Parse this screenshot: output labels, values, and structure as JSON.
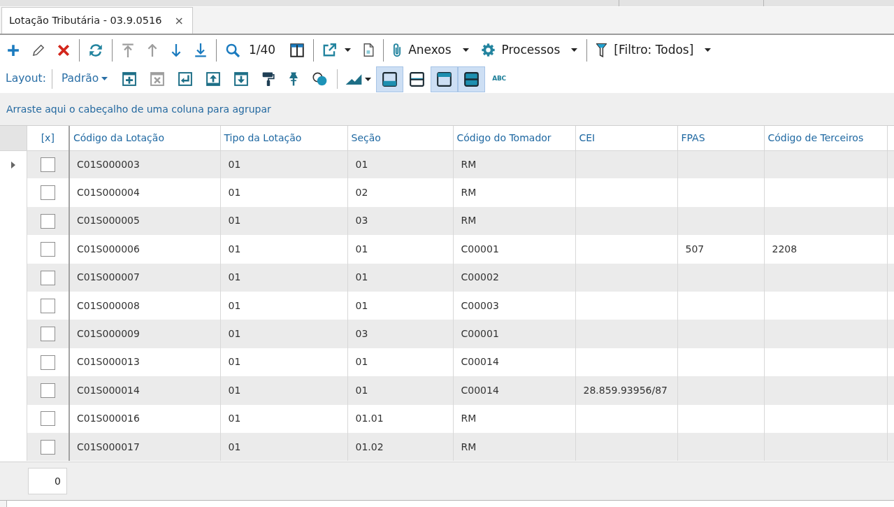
{
  "tabs": [
    {
      "label": "Lotação Tributária - 03.9.0516",
      "close": "×",
      "selected": true
    }
  ],
  "toolbar": [
    {
      "kind": "button",
      "disabled": false
    },
    {
      "kind": "button",
      "disabled": false
    },
    {
      "kind": "button",
      "disabled": false
    },
    {
      "kind": "separator"
    },
    {
      "kind": "button",
      "disabled": false
    },
    {
      "kind": "separator"
    },
    {
      "kind": "button",
      "disabled": true
    },
    {
      "kind": "button",
      "disabled": true
    },
    {
      "kind": "button",
      "disabled": false
    },
    {
      "kind": "button",
      "disabled": false
    },
    {
      "kind": "separator"
    },
    {
      "kind": "button",
      "disabled": false
    },
    {
      "kind": "text",
      "text": "1/40"
    },
    {
      "kind": "button",
      "disabled": false
    },
    {
      "kind": "separator"
    },
    {
      "kind": "dropdown-button",
      "disabled": false
    },
    {
      "kind": "button",
      "disabled": false
    },
    {
      "kind": "separator"
    },
    {
      "kind": "menu",
      "label": "Anexos",
      "disabled": false
    },
    {
      "kind": "menu",
      "label": "Processos",
      "disabled": false
    },
    {
      "kind": "separator"
    },
    {
      "kind": "menu",
      "label": "[Filtro: Todos]",
      "disabled": false
    }
  ],
  "layout_bar": {
    "label": "Layout:",
    "dropdown": "Padrão",
    "items": [
      {
        "kind": "button",
        "disabled": false
      },
      {
        "kind": "button",
        "disabled": true
      },
      {
        "kind": "button",
        "disabled": false
      },
      {
        "kind": "button",
        "disabled": false
      },
      {
        "kind": "button",
        "disabled": false
      },
      {
        "kind": "button",
        "disabled": false
      },
      {
        "kind": "button",
        "disabled": false
      },
      {
        "kind": "button",
        "disabled": false
      },
      {
        "kind": "separator"
      },
      {
        "kind": "dropdown-button",
        "disabled": false
      },
      {
        "kind": "toggle",
        "selected": true
      },
      {
        "kind": "toggle",
        "selected": false
      },
      {
        "kind": "toggle",
        "selected": true
      },
      {
        "kind": "toggle",
        "selected": true
      },
      {
        "kind": "text-button",
        "label": "ABC"
      }
    ]
  },
  "group_panel": {
    "hint": "Arraste aqui o cabeçalho de uma coluna para agrupar"
  },
  "table": {
    "checkbox_column": {
      "label": "[x]"
    },
    "columns": [
      {
        "label": "Código da Lotação"
      },
      {
        "label": "Tipo da Lotação"
      },
      {
        "label": "Seção"
      },
      {
        "label": "Código do Tomador"
      },
      {
        "label": "CEI"
      },
      {
        "label": "FPAS"
      },
      {
        "label": "Código de Terceiros"
      }
    ],
    "rows": [
      {
        "current": true,
        "checked": false,
        "cells": [
          "C01S000003",
          "01",
          "01",
          "RM",
          null,
          null,
          null
        ]
      },
      {
        "current": false,
        "checked": false,
        "cells": [
          "C01S000004",
          "01",
          "02",
          "RM",
          null,
          null,
          null
        ]
      },
      {
        "current": false,
        "checked": false,
        "cells": [
          "C01S000005",
          "01",
          "03",
          "RM",
          null,
          null,
          null
        ]
      },
      {
        "current": false,
        "checked": false,
        "cells": [
          "C01S000006",
          "01",
          "01",
          "C00001",
          null,
          "507",
          "2208"
        ]
      },
      {
        "current": false,
        "checked": false,
        "cells": [
          "C01S000007",
          "01",
          "01",
          "C00002",
          null,
          null,
          null
        ]
      },
      {
        "current": false,
        "checked": false,
        "cells": [
          "C01S000008",
          "01",
          "01",
          "C00003",
          null,
          null,
          null
        ]
      },
      {
        "current": false,
        "checked": false,
        "cells": [
          "C01S000009",
          "01",
          "03",
          "C00001",
          null,
          null,
          null
        ]
      },
      {
        "current": false,
        "checked": false,
        "cells": [
          "C01S000013",
          "01",
          "01",
          "C00014",
          null,
          null,
          null
        ]
      },
      {
        "current": false,
        "checked": false,
        "cells": [
          "C01S000014",
          "01",
          "01",
          "C00014",
          "28.859.93956/87",
          null,
          null
        ]
      },
      {
        "current": false,
        "checked": false,
        "cells": [
          "C01S000016",
          "01",
          "01.01",
          "RM",
          null,
          null,
          null
        ]
      },
      {
        "current": false,
        "checked": false,
        "cells": [
          "C01S000017",
          "01",
          "01.02",
          "RM",
          null,
          null,
          null
        ]
      }
    ]
  },
  "footer": {
    "count": "0"
  }
}
